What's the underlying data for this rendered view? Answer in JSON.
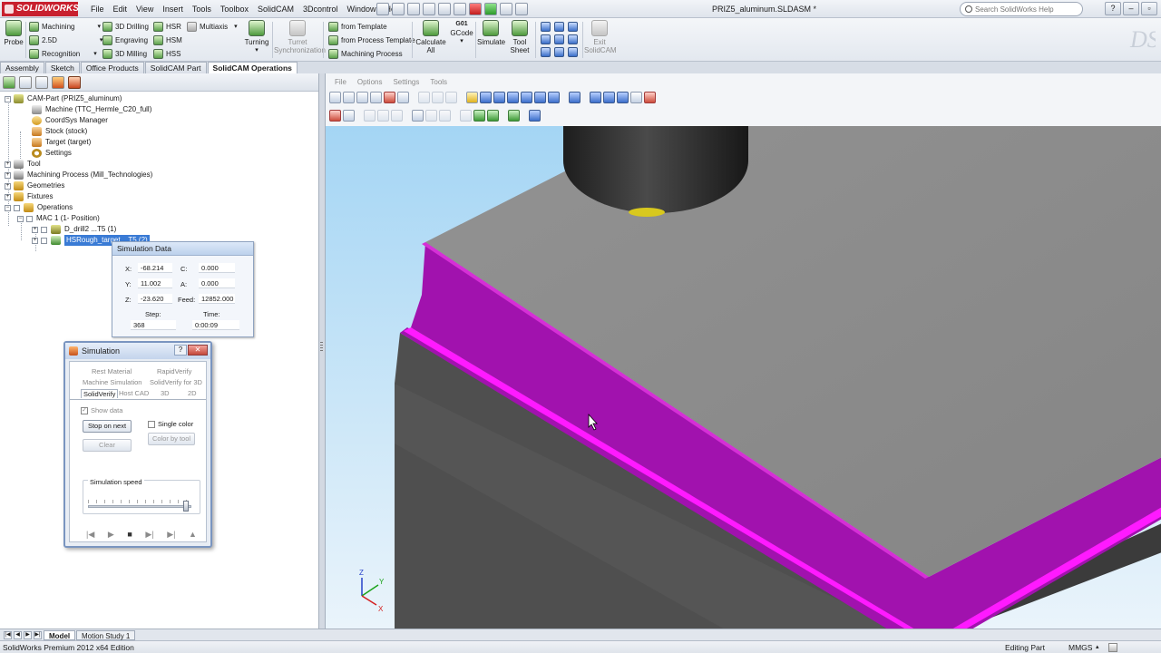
{
  "app": {
    "brand": "SOLIDWORKS",
    "document_title": "PRIZ5_aluminum.SLDASM *",
    "status_edition": "SolidWorks Premium 2012 x64 Edition",
    "status_mode": "Editing Part",
    "status_units": "MMGS"
  },
  "menu": [
    "File",
    "Edit",
    "View",
    "Insert",
    "Tools",
    "Toolbox",
    "SolidCAM",
    "3Dcontrol",
    "Window",
    "Help"
  ],
  "help_search": {
    "placeholder": "Search SolidWorks Help"
  },
  "command_manager": {
    "probe": "Probe",
    "machining": "Machining",
    "drilling3d": "3D Drilling",
    "hsr": "HSR",
    "multiaxis": "Multiaxis",
    "twofive_d": "2.5D",
    "engraving": "Engraving",
    "hsm": "HSM",
    "recognition": "Recognition",
    "milling3d": "3D Milling",
    "hss": "HSS",
    "turning": "Turning",
    "turret_sync": [
      "Turret",
      "Synchronization"
    ],
    "from_template": "from Template",
    "from_process_template": "from Process Template",
    "machining_process": "Machining Process",
    "calculate_all": [
      "Calculate",
      "All"
    ],
    "gcode": [
      "G01",
      "GCode"
    ],
    "simulate": "Simulate",
    "tool_sheet": [
      "Tool",
      "Sheet"
    ],
    "exit_solidcam": [
      "Exit",
      "SolidCAM"
    ]
  },
  "cm_tabs": [
    "Assembly",
    "Sketch",
    "Office Products",
    "SolidCAM Part",
    "SolidCAM Operations"
  ],
  "tree": {
    "cam_part": "CAM-Part (PRIZ5_aluminum)",
    "machine": "Machine (TTC_Hermle_C20_full)",
    "coordsys": "CoordSys Manager",
    "stock": "Stock (stock)",
    "target": "Target (target)",
    "settings": "Settings",
    "tool": "Tool",
    "machining_process": "Machining Process (Mill_Technologies)",
    "geometries": "Geometries",
    "fixtures": "Fixtures",
    "operations": "Operations",
    "mac": "MAC 1 (1- Position)",
    "op1": "D_drill2 ...T5 (1)",
    "op2": "HSRough_target... T5 (2)"
  },
  "sim_data": {
    "title": "Simulation Data",
    "x_label": "X:",
    "x": "-68.214",
    "y_label": "Y:",
    "y": "11.002",
    "z_label": "Z:",
    "z": "-23.620",
    "c_label": "C:",
    "c": "0.000",
    "a_label": "A:",
    "a": "0.000",
    "feed_label": "Feed:",
    "feed": "12852.000",
    "step_label": "Step:",
    "step": "368",
    "time_label": "Time:",
    "time": "0:00:09"
  },
  "simulation_dialog": {
    "title": "Simulation",
    "help": "?",
    "tabs": {
      "rest_material": "Rest Material",
      "rapid_verify": "RapidVerify",
      "machine_simulation": "Machine Simulation",
      "solidverify_3d": "SolidVerify for 3D",
      "solidverify": "SolidVerify",
      "host_cad": "Host CAD",
      "t3d": "3D",
      "t2d": "2D"
    },
    "show_data": "Show data",
    "stop_on_next": "Stop on next",
    "single_color": "Single color",
    "clear": "Clear",
    "color_by_tool": "Color by tool",
    "simulation_speed": "Simulation speed",
    "speed_level_fraction": 0.95
  },
  "viewport": {
    "menu": [
      "File",
      "Options",
      "Settings",
      "Tools"
    ]
  },
  "triad": {
    "x": "X",
    "y": "Y",
    "z": "Z"
  },
  "bottom_tabs": [
    "Model",
    "Motion Study 1"
  ],
  "colors": {
    "stock_gray": "#8e8e8e",
    "machined_magenta": "#a112ae",
    "edge_magenta": "#ff1aff",
    "sky_top": "#a8d8f5",
    "selection": "#3a7bd5"
  }
}
